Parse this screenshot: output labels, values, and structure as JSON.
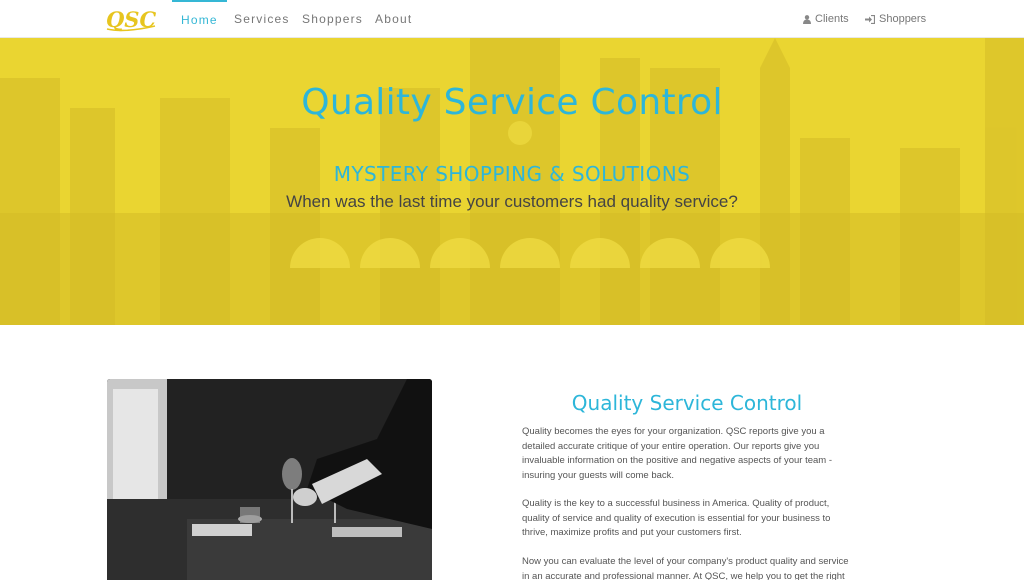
{
  "brand": {
    "logo_text": "QSC",
    "accent_color": "#35b7d5",
    "hero_color": "#ead531"
  },
  "nav": {
    "links": [
      {
        "label": "Home",
        "active": true
      },
      {
        "label": "Services",
        "active": false
      },
      {
        "label": "Shoppers",
        "active": false
      },
      {
        "label": "About",
        "active": false
      }
    ],
    "right": [
      {
        "label": "Clients",
        "icon": "user-icon"
      },
      {
        "label": "Shoppers",
        "icon": "sign-in-icon"
      }
    ]
  },
  "hero": {
    "title": "Quality Service Control",
    "subtitle": "MYSTERY SHOPPING & SOLUTIONS",
    "question": "When was the last time your customers had quality service?"
  },
  "content": {
    "title": "Quality Service Control",
    "paragraphs": [
      "Quality becomes the eyes for your organization. QSC reports give you a detailed accurate critique of your entire operation. Our reports give you invaluable information on the positive and negative aspects of your team - insuring your guests will come back.",
      "Quality is the key to a successful business in America. Quality of product, quality of service and quality of execution is essential for your business to thrive, maximize profits and put your customers first.",
      "Now you can evaluate the level of your company's product quality and service in an accurate and professional manner. At QSC, we help you to get the right"
    ]
  }
}
